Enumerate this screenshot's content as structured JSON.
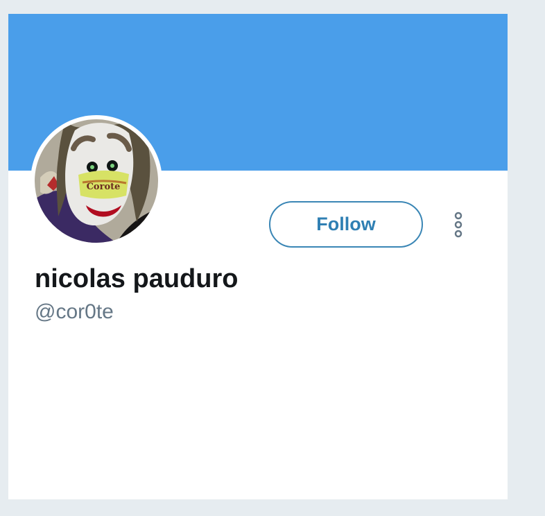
{
  "profile": {
    "display_name": "nicolas pauduro",
    "username": "@cor0te",
    "avatar_text": "Corote"
  },
  "actions": {
    "follow_label": "Follow",
    "more_icon": "vertical-ellipsis-icon"
  },
  "colors": {
    "page_background": "#e6ecf0",
    "banner": "#4a9eea",
    "follow_text": "#2f7fb3",
    "follow_border": "#3a86b5",
    "name": "#14171a",
    "handle": "#657786"
  }
}
